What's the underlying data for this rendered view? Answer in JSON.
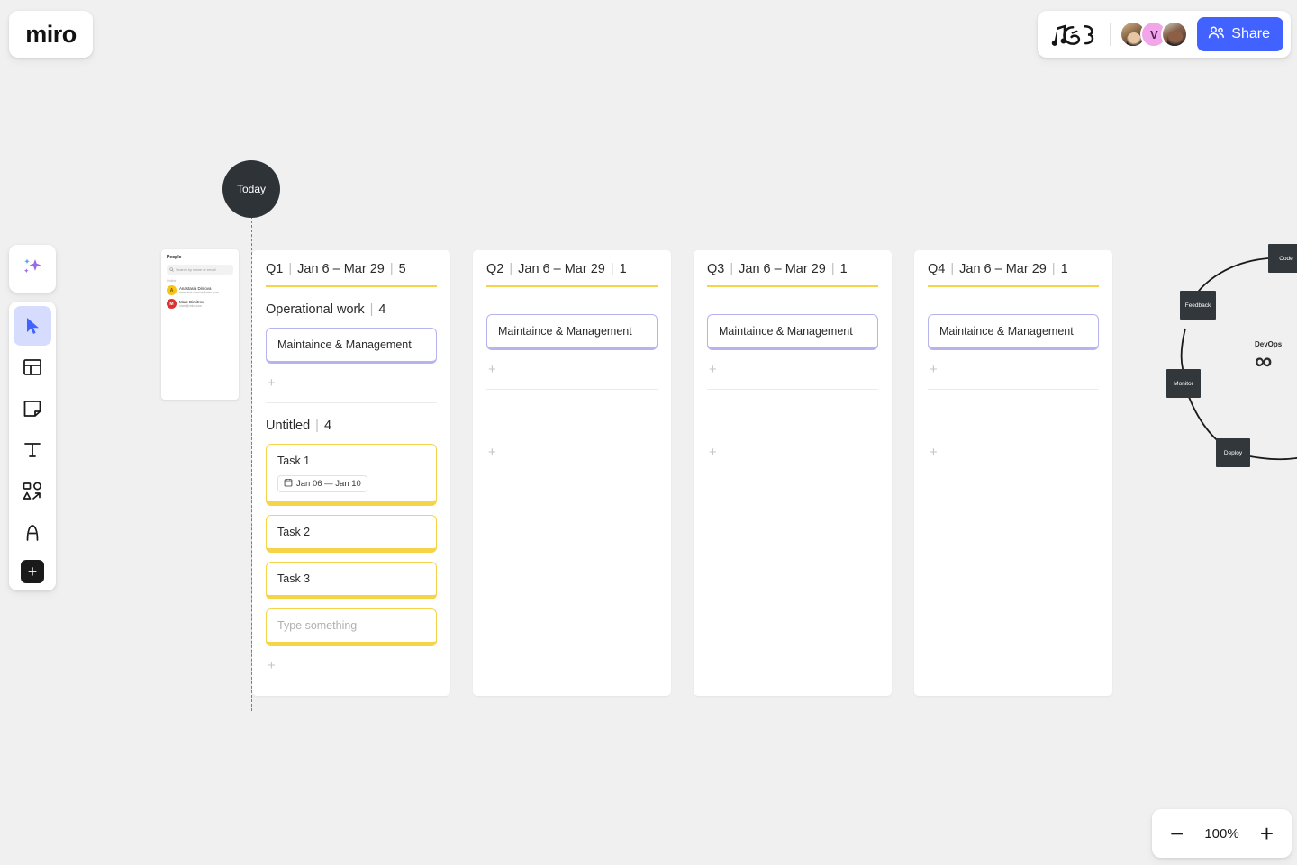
{
  "app": {
    "logo": "miro"
  },
  "topbar": {
    "doodle_icon": "music-note-doodle-icon",
    "avatars": [
      {
        "name": "avatar-1",
        "initial": ""
      },
      {
        "name": "avatar-2",
        "initial": "V"
      },
      {
        "name": "avatar-3",
        "initial": ""
      }
    ],
    "share_label": "Share",
    "share_icon": "people-icon",
    "share_color": "#4262ff"
  },
  "toolbar": {
    "ai_icon": "sparkles-icon",
    "items": [
      {
        "icon": "cursor-select-icon",
        "name": "select-tool",
        "active": true
      },
      {
        "icon": "template-frame-icon",
        "name": "templates-tool",
        "active": false
      },
      {
        "icon": "sticky-note-icon",
        "name": "sticky-note-tool",
        "active": false
      },
      {
        "icon": "text-icon",
        "name": "text-tool",
        "active": false
      },
      {
        "icon": "shapes-arrow-icon",
        "name": "shapes-tool",
        "active": false
      },
      {
        "icon": "pen-draw-icon",
        "name": "pen-tool",
        "active": false
      }
    ],
    "add_label": "+"
  },
  "canvas": {
    "today_marker": "Today",
    "people_panel": {
      "title": "People",
      "search_placeholder": "Search by name or email",
      "section_label": "Online",
      "members": [
        {
          "initial": "A",
          "name": "Anastasia Dimova",
          "email": "anastasia.dimova@miro.com",
          "color": "#f5c518"
        },
        {
          "initial": "M",
          "name": "Marc Dimitrov",
          "email": "marc@miro.com",
          "color": "#e03131"
        }
      ]
    },
    "devops": {
      "label": "DevOps",
      "symbol": "∞",
      "nodes": [
        {
          "label": "Code"
        },
        {
          "label": "Feedback"
        },
        {
          "label": "Monitor"
        },
        {
          "label": "Deploy"
        }
      ]
    }
  },
  "board": {
    "accent_color": "#f6d44a",
    "card_lavender_border": "#b7b3ef",
    "add_label": "+",
    "columns": [
      {
        "quarter": "Q1",
        "sep": "|",
        "range": "Jan 6 – Mar 29",
        "count": "5",
        "groups": [
          {
            "title": "Operational work",
            "count": "4",
            "cards": [
              {
                "title": "Maintaince & Management",
                "style": "lav"
              }
            ]
          },
          {
            "title": "Untitled",
            "count": "4",
            "cards": [
              {
                "title": "Task 1",
                "style": "yel",
                "date_icon": "calendar-icon",
                "date": "Jan 06 — Jan 10"
              },
              {
                "title": "Task 2",
                "style": "yel"
              },
              {
                "title": "Task 3",
                "style": "yel"
              },
              {
                "title": "Type something",
                "style": "yel",
                "placeholder": true
              }
            ]
          }
        ]
      },
      {
        "quarter": "Q2",
        "sep": "|",
        "range": "Jan 6 – Mar 29",
        "count": "1",
        "groups": [
          {
            "title": "",
            "count": "",
            "cards": [
              {
                "title": "Maintaince & Management",
                "style": "lav"
              }
            ]
          },
          {
            "title": "",
            "count": "",
            "cards": []
          }
        ]
      },
      {
        "quarter": "Q3",
        "sep": "|",
        "range": "Jan 6 – Mar 29",
        "count": "1",
        "groups": [
          {
            "title": "",
            "count": "",
            "cards": [
              {
                "title": "Maintaince & Management",
                "style": "lav"
              }
            ]
          },
          {
            "title": "",
            "count": "",
            "cards": []
          }
        ]
      },
      {
        "quarter": "Q4",
        "sep": "|",
        "range": "Jan 6 – Mar 29",
        "count": "1",
        "groups": [
          {
            "title": "",
            "count": "",
            "cards": [
              {
                "title": "Maintaince & Management",
                "style": "lav"
              }
            ]
          },
          {
            "title": "",
            "count": "",
            "cards": []
          }
        ]
      }
    ]
  },
  "zoom_control": {
    "minus": "−",
    "value": "100%",
    "plus": "+"
  }
}
